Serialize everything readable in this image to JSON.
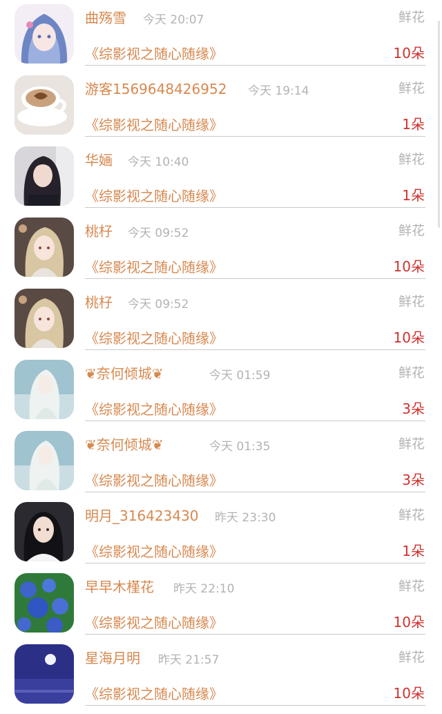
{
  "list": {
    "items": [
      {
        "name": "曲殇雪",
        "time": "今天 20:07",
        "gift": "鲜花",
        "work": "《综影视之随心随缘》",
        "count": "10朵",
        "avatar": "anime-girl-blue-hair"
      },
      {
        "name": "游客1569648426952",
        "time": "今天 19:14",
        "gift": "鲜花",
        "work": "《综影视之随心随缘》",
        "count": "1朵",
        "avatar": "coffee-cup"
      },
      {
        "name": "华婳",
        "time": "今天 10:40",
        "gift": "鲜花",
        "work": "《综影视之随心随缘》",
        "count": "1朵",
        "avatar": "girl-portrait"
      },
      {
        "name": "桃杍",
        "time": "今天 09:52",
        "gift": "鲜花",
        "work": "《综影视之随心随缘》",
        "count": "10朵",
        "avatar": "anime-blonde-girl"
      },
      {
        "name": "桃杍",
        "time": "今天 09:52",
        "gift": "鲜花",
        "work": "《综影视之随心随缘》",
        "count": "10朵",
        "avatar": "anime-blonde-girl"
      },
      {
        "name": "奈何倾城",
        "time": "今天 01:59",
        "gift": "鲜花",
        "work": "《综影视之随心随缘》",
        "count": "3朵",
        "avatar": "anime-white-hair-man"
      },
      {
        "name": "奈何倾城",
        "time": "今天 01:35",
        "gift": "鲜花",
        "work": "《综影视之随心随缘》",
        "count": "3朵",
        "avatar": "anime-white-hair-man"
      },
      {
        "name": "明月_316423430",
        "time": "昨天 23:30",
        "gift": "鲜花",
        "work": "《综影视之随心随缘》",
        "count": "1朵",
        "avatar": "woman-portrait"
      },
      {
        "name": "早早木槿花",
        "time": "昨天 22:10",
        "gift": "鲜花",
        "work": "《综影视之随心随缘》",
        "count": "10朵",
        "avatar": "blue-hydrangea"
      },
      {
        "name": "星海月明",
        "time": "昨天 21:57",
        "gift": "鲜花",
        "work": "《综影视之随心随缘》",
        "count": "10朵",
        "avatar": "moon-night"
      }
    ]
  }
}
